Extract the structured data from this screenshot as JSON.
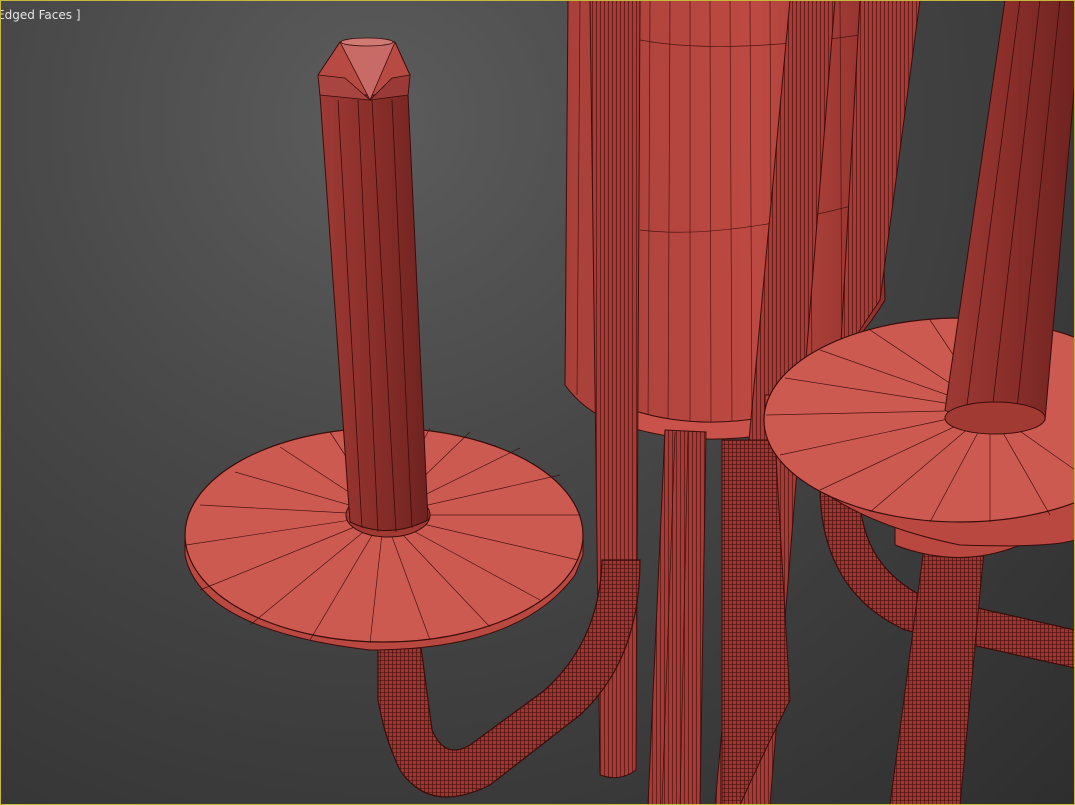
{
  "viewport": {
    "label": "Edged Faces ]",
    "border_color": "#c8b83a",
    "background": "#474747"
  },
  "scene": {
    "object_color": "#b5423c",
    "wire_color": "#3a0d0b",
    "objects": [
      "candle-stick-left",
      "drip-dish-left",
      "curved-arm-left",
      "center-column",
      "center-rods",
      "candle-stick-right",
      "drip-dish-right",
      "curved-arm-right"
    ]
  }
}
